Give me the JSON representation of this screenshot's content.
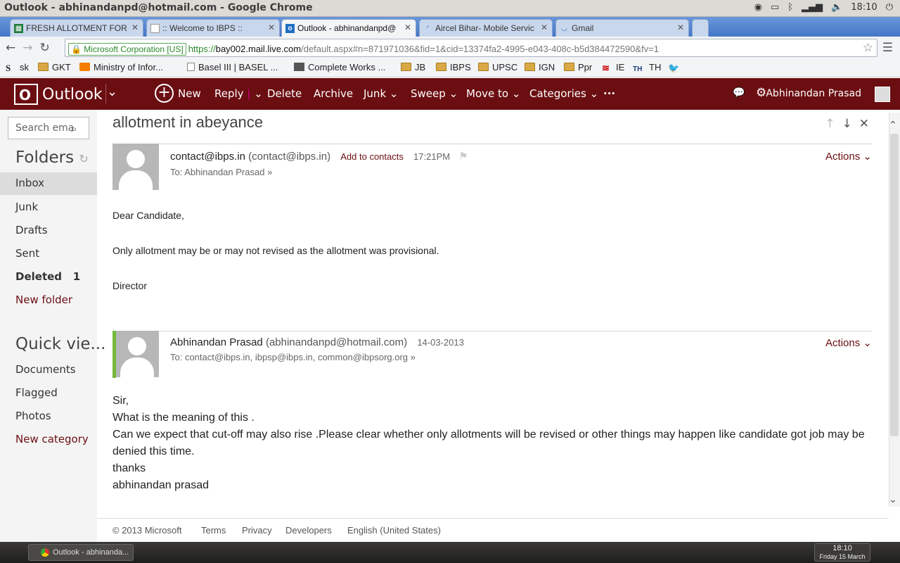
{
  "os": {
    "window_title": "Outlook - abhinandanpd@hotmail.com - Google Chrome",
    "clock": "18:10"
  },
  "tabs": [
    {
      "label": "FRESH ALLOTMENT FOR IE",
      "icon": "spreadsheet-icon"
    },
    {
      "label": ":: Welcome to IBPS ::",
      "icon": "page-icon"
    },
    {
      "label": "Outlook - abhinandanpd@",
      "icon": "outlook-icon",
      "active": true
    },
    {
      "label": "Aircel Bihar- Mobile Servic",
      "icon": "loading-icon"
    },
    {
      "label": "Gmail",
      "icon": "loading-icon"
    }
  ],
  "address": {
    "ssl_label": "Microsoft Corporation [US]",
    "scheme": "https://",
    "host": "bay002.mail.live.com",
    "path": "/default.aspx#n=871971036&fid=1&cid=13374fa2-4995-e043-408c-b5d384472590&fv=1"
  },
  "bookmarks": [
    {
      "label": "sk",
      "icon": "s-icon"
    },
    {
      "label": "GKT",
      "icon": "folder-icon"
    },
    {
      "label": "Ministry of Infor...",
      "icon": "blogger-icon"
    },
    {
      "label": "Basel III | BASEL ...",
      "icon": "page-icon"
    },
    {
      "label": "Complete Works ...",
      "icon": "portrait-icon"
    },
    {
      "label": "JB",
      "icon": "folder-icon"
    },
    {
      "label": "IBPS",
      "icon": "folder-icon"
    },
    {
      "label": "UPSC",
      "icon": "folder-icon"
    },
    {
      "label": "IGN",
      "icon": "folder-icon"
    },
    {
      "label": "Ppr",
      "icon": "folder-icon"
    },
    {
      "label": "IE",
      "icon": "ie-logo-icon"
    },
    {
      "label": "TH",
      "icon": "th-logo-icon"
    },
    {
      "label": "",
      "icon": "twitter-icon"
    }
  ],
  "outlook": {
    "logo_text": "Outlook",
    "toolbar": {
      "new": "New",
      "reply": "Reply",
      "delete": "Delete",
      "archive": "Archive",
      "junk": "Junk",
      "sweep": "Sweep",
      "move_to": "Move to",
      "categories": "Categories",
      "more": "···"
    },
    "user_name": "Abhinandan Prasad"
  },
  "sidebar": {
    "search_placeholder": "Search ema",
    "folders_heading": "Folders",
    "folders": [
      {
        "label": "Inbox"
      },
      {
        "label": "Junk"
      },
      {
        "label": "Drafts"
      },
      {
        "label": "Sent"
      },
      {
        "label": "Deleted",
        "count": "1"
      },
      {
        "label": "New folder"
      }
    ],
    "quick_views_heading": "Quick vie...",
    "quick_views": [
      {
        "label": "Documents"
      },
      {
        "label": "Flagged"
      },
      {
        "label": "Photos"
      },
      {
        "label": "New category"
      }
    ]
  },
  "conversation": {
    "subject": "allotment in abeyance",
    "actions_label": "Actions",
    "messages": [
      {
        "sender_name": "contact@ibps.in",
        "sender_addr": "(contact@ibps.in)",
        "add_contact": "Add to contacts",
        "time": "17:21PM",
        "to": "To: Abhinandan Prasad",
        "body": [
          "Dear Candidate,",
          "Only allotment may be or may not revised as the allotment was provisional.",
          "Director"
        ]
      },
      {
        "sender_name": "Abhinandan Prasad",
        "sender_addr": "(abhinandanpd@hotmail.com)",
        "time": "14-03-2013",
        "to": "To: contact@ibps.in, ibpsp@ibps.in, common@ibpsorg.org",
        "body": [
          "Sir,",
          "What is the meaning of this .",
          "Can we expect that cut-off may also rise .Please clear whether only allotments will be revised or other things may happen like candidate got job may be denied this time.",
          "thanks",
          "abhinandan prasad"
        ]
      }
    ]
  },
  "footer": {
    "copyright": "© 2013 Microsoft",
    "terms": "Terms",
    "privacy": "Privacy",
    "developers": "Developers",
    "language": "English (United States)"
  },
  "taskbar": {
    "window_item": "Outlook - abhinanda...",
    "time": "18:10",
    "date": "Friday 15 March"
  }
}
